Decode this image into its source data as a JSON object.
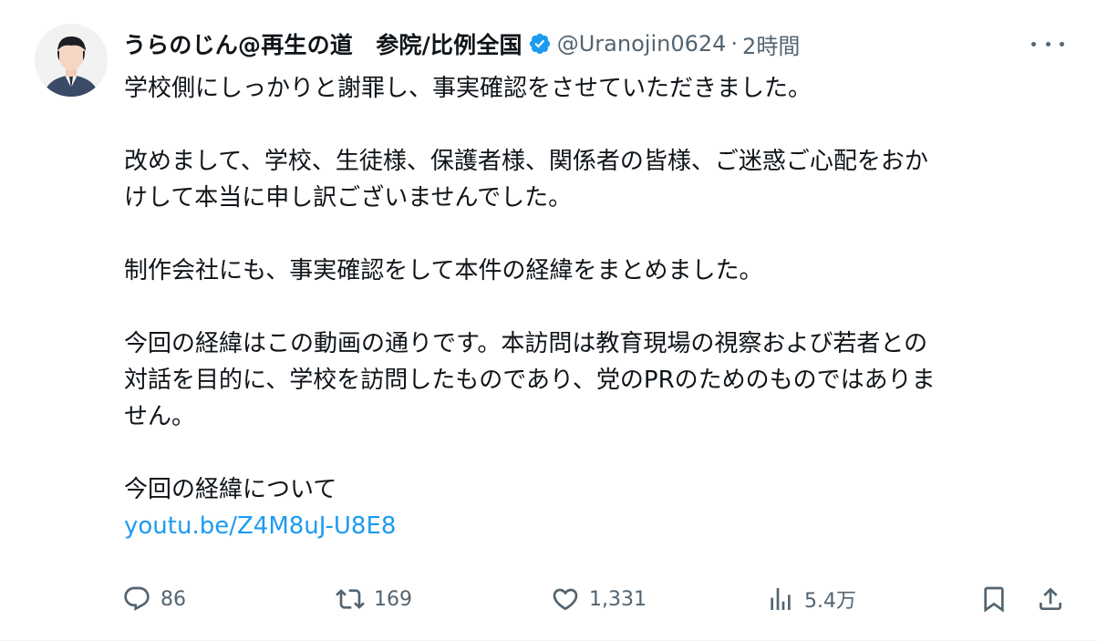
{
  "author": {
    "display_name": "うらのじん@再生の道　参院/比例全国",
    "handle": "@Uranojin0624",
    "separator": "·",
    "time": "2時間"
  },
  "tweet": {
    "line1": "学校側にしっかりと謝罪し、事実確認をさせていただきました。",
    "line2": "改めまして、学校、生徒様、保護者様、関係者の皆様、ご迷惑ご心配をおか\nけして本当に申し訳ございませんでした。",
    "line3": "制作会社にも、事実確認をして本件の経緯をまとめました。",
    "line4": "今回の経緯はこの動画の通りです。本訪問は教育現場の視察および若者との\n対話を目的に、学校を訪問したものであり、党のPRのためのものではありま\nせん。",
    "line5": "今回の経緯について",
    "link": "youtu.be/Z4M8uJ-U8E8"
  },
  "actions": {
    "replies": "86",
    "reposts": "169",
    "likes": "1,331",
    "views": "5.4万"
  },
  "icons": {
    "verified": "verified-badge-icon",
    "more": "more-icon",
    "reply": "reply-icon",
    "repost": "repost-icon",
    "like": "heart-icon",
    "views": "views-chart-icon",
    "bookmark": "bookmark-icon",
    "share": "share-icon"
  },
  "colors": {
    "link": "#1d9bf0",
    "verified": "#1d9bf0",
    "secondary_text": "#536471",
    "primary_text": "#0f1419"
  }
}
